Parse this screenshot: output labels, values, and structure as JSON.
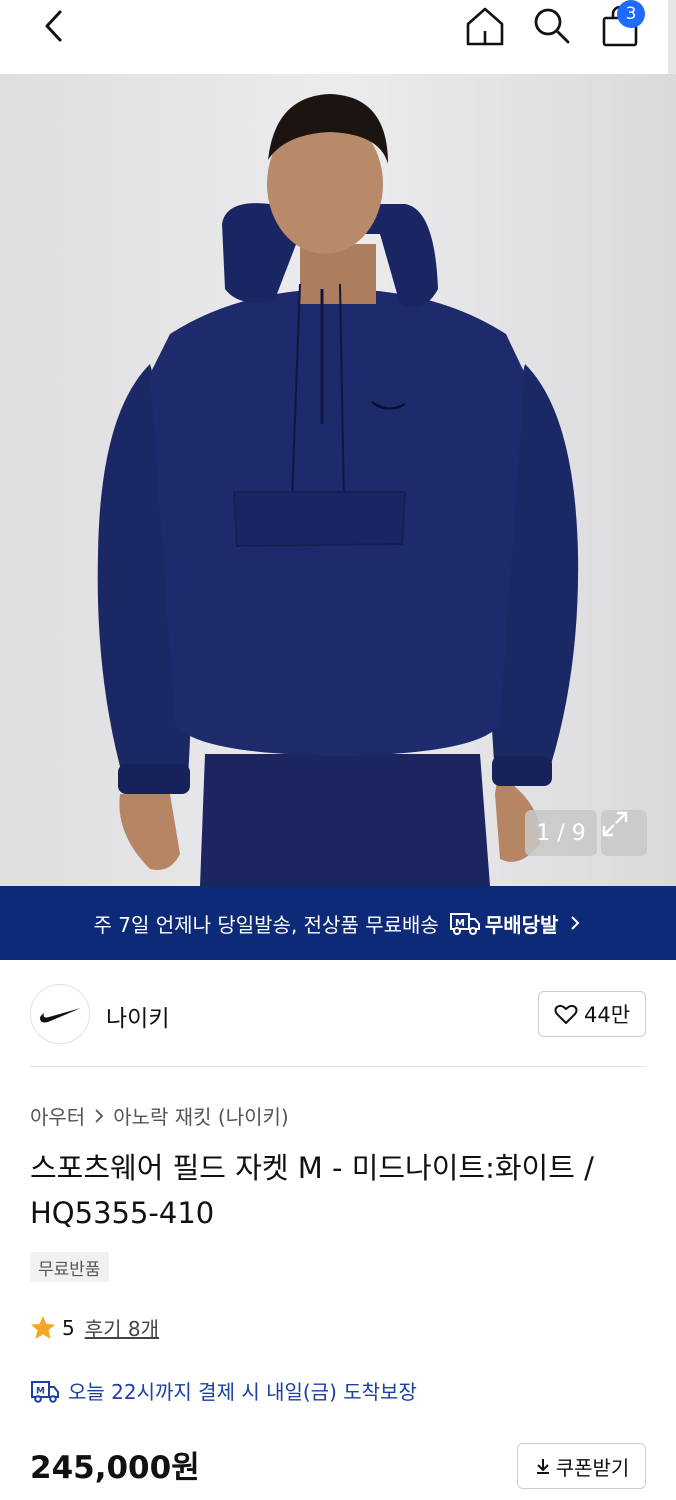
{
  "header": {
    "cart_count": "3",
    "icons": [
      "chevron-left-icon",
      "home-icon",
      "search-icon",
      "shopping-bag-icon"
    ]
  },
  "gallery": {
    "counter": "1 / 9",
    "current": 1,
    "total": 9
  },
  "banner": {
    "text": "주 7일 언제나 당일발송, 전상품 무료배송",
    "brand": "무배당발",
    "color": "#0d2a78"
  },
  "brand": {
    "name": "나이키",
    "likes": "44만"
  },
  "product": {
    "breadcrumb": [
      "아우터",
      "아노락 재킷 (나이키)"
    ],
    "title": "스포츠웨어 필드 자켓 M - 미드나이트:화이트 / HQ5355-410",
    "tag": "무료반품",
    "rating": "5",
    "reviews": "후기 8개",
    "delivery": "오늘 22시까지 결제 시 내일(금) 도착보장",
    "price": "245,000원",
    "coupon_label": "쿠폰받기"
  },
  "colors": {
    "accent": "#1f6bff",
    "banner": "#0d2a78",
    "delivery_text": "#1b3fa3",
    "star": "#f5a623",
    "jacket": "#1a2660"
  }
}
